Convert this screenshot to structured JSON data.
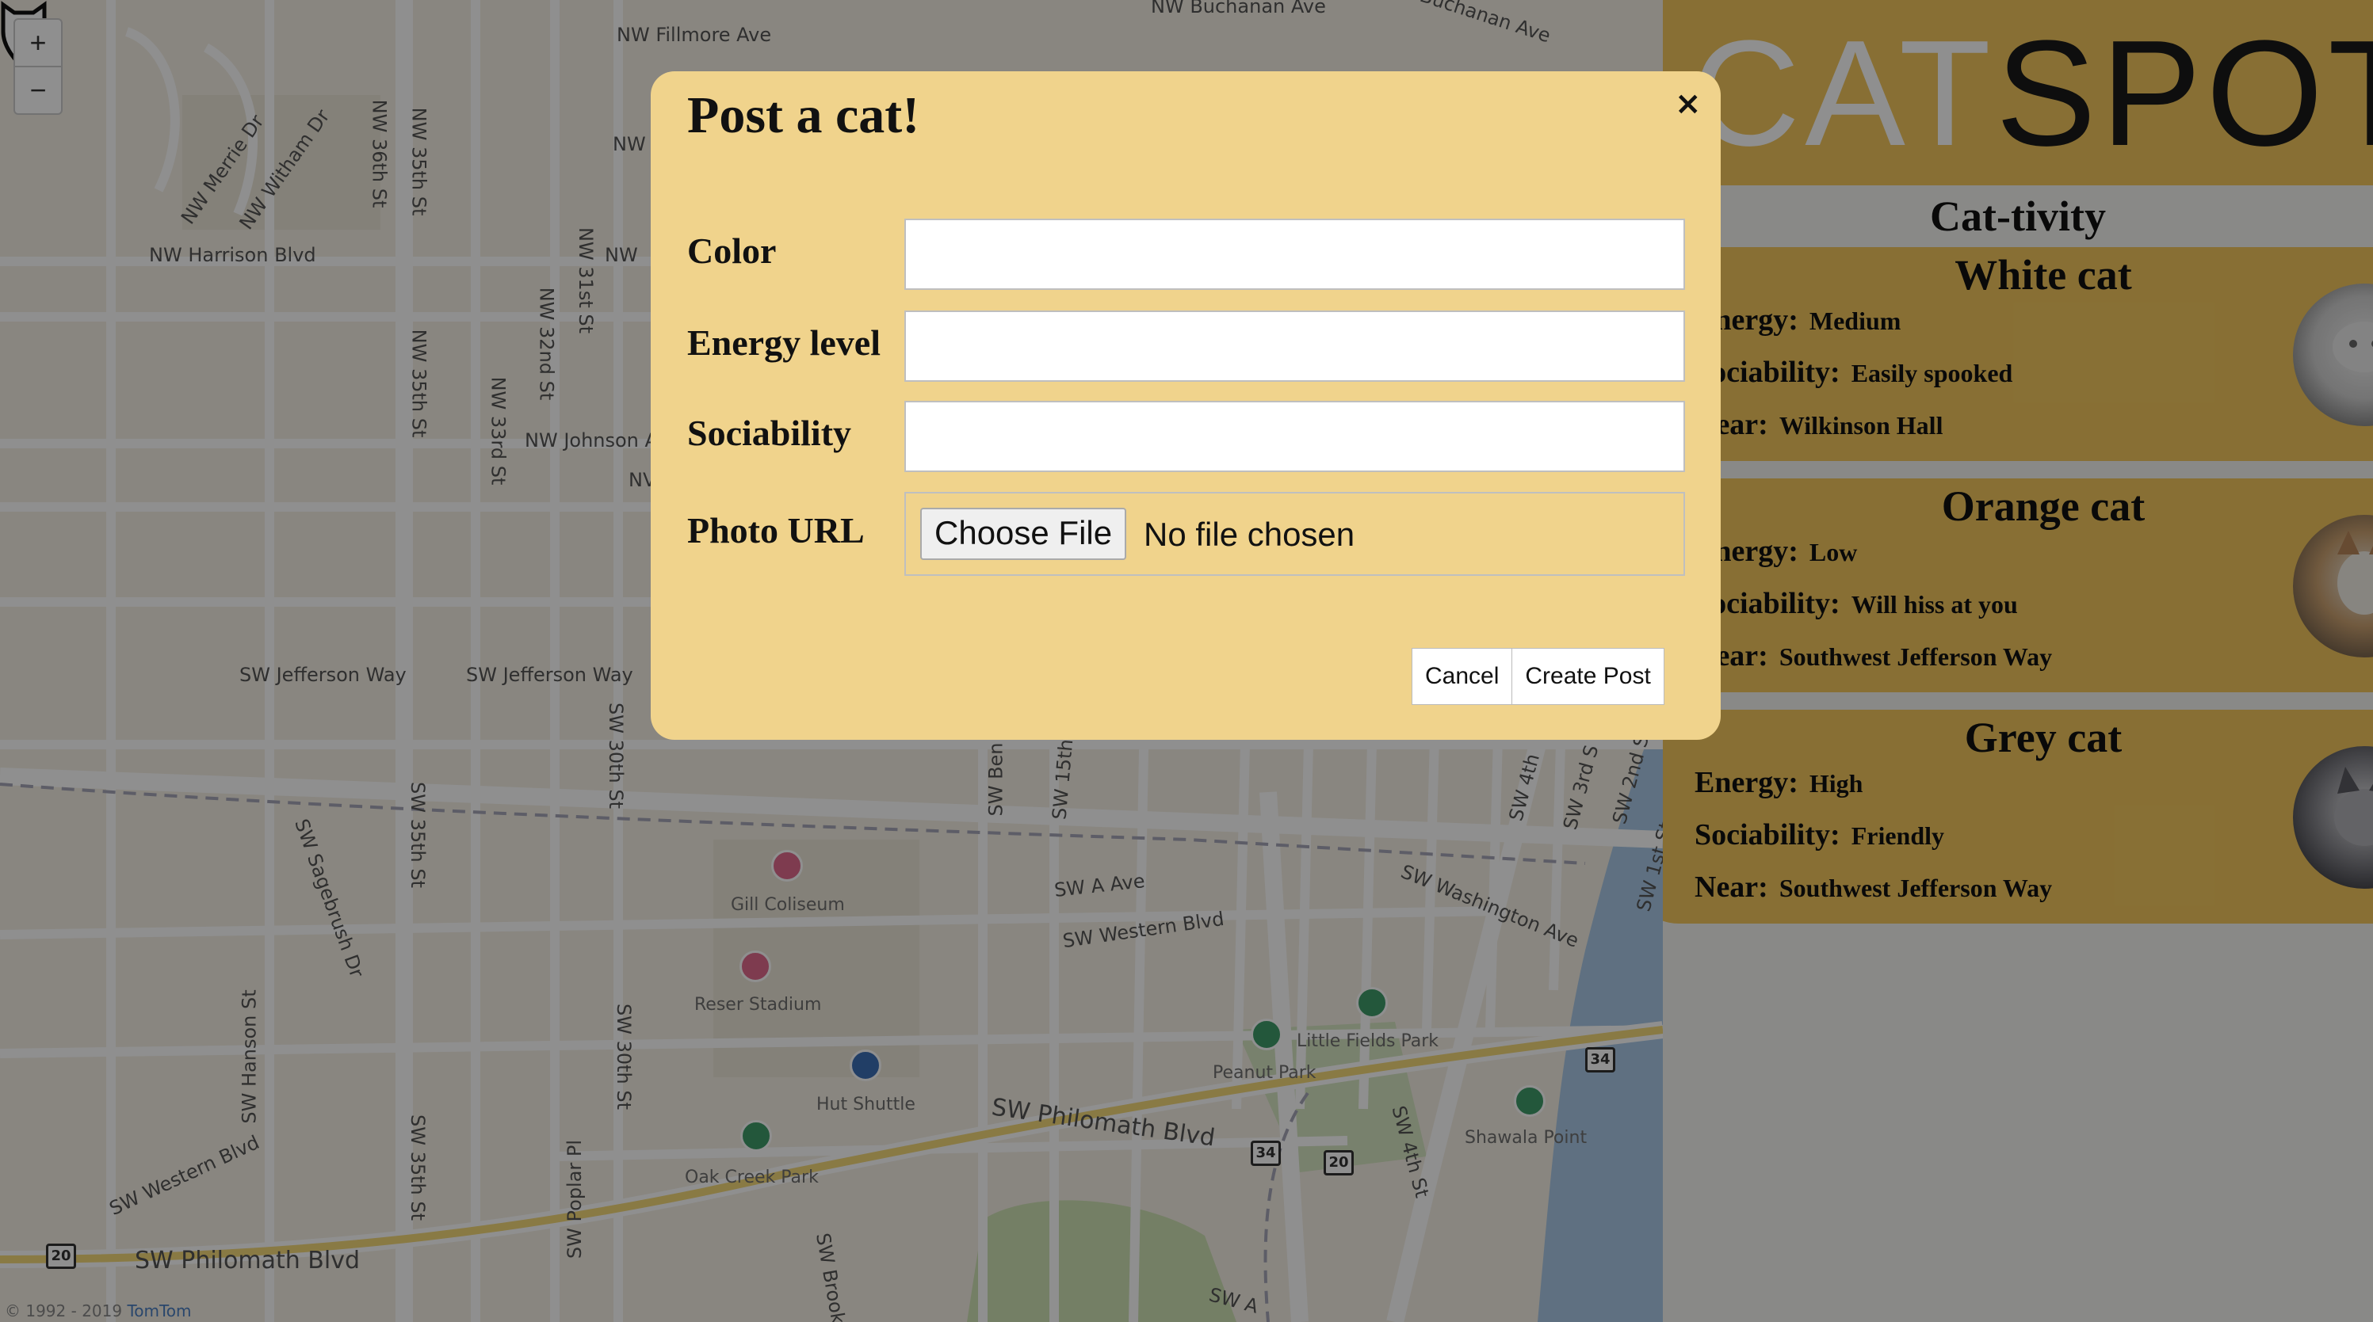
{
  "map": {
    "zoom_in": "+",
    "zoom_out": "−",
    "attribution_prefix": "© 1992 - 2019 ",
    "attribution_link": "TomTom",
    "streets": [
      "NW Fillmore Ave",
      "NW Buchanan Ave",
      "NW Buchanan Ave",
      "NW Harrison Blvd",
      "NW Merrie Dr",
      "NW Witham Dr",
      "NW 36th St",
      "NW 35th St",
      "NW 35th St",
      "NW 33rd St",
      "NW 32nd St",
      "NW 31st St",
      "NW Johnson A",
      "SW Jefferson Way",
      "SW Jefferson Way",
      "SW 30th St",
      "SW Sagebrush Dr",
      "SW 35th St",
      "SW Hanson St",
      "SW 30th St",
      "SW Western Blvd",
      "SW Western Blvd",
      "SW Philomath Blvd",
      "SW Philomath Blvd",
      "SW Poplar Pl",
      "SW 35th St",
      "SW A Ave",
      "SW Washington Ave",
      "SW 4th St",
      "SW 15th",
      "SW Ben",
      "SW 4th",
      "SW 3rd S",
      "SW 2nd S",
      "SW 1st St",
      "NW",
      "NW",
      "NV",
      "SW Brook",
      "SW A"
    ],
    "pois": [
      "Gill Coliseum",
      "Reser Stadium",
      "Hut Shuttle",
      "Oak Creek Park",
      "Little Fields Park",
      "Peanut Park",
      "Shawala Point"
    ],
    "shields": [
      "20",
      "34",
      "20",
      "34",
      "20"
    ],
    "colors": {
      "land": "#f4efe4",
      "road": "#ffffff",
      "river": "#a9c8e6",
      "park": "#cfe3b4"
    }
  },
  "sidebar": {
    "logo_part1": "CAT",
    "logo_part2": "SPOT",
    "activity_title": "Cat-tivity",
    "cats": [
      {
        "name": "White cat",
        "energy_label": "Energy:",
        "energy": "Medium",
        "sociability_label": "Sociability:",
        "sociability": "Easily spooked",
        "near_label": "Near:",
        "near": "Wilkinson Hall",
        "photo": "white-cat-photo"
      },
      {
        "name": "Orange cat",
        "energy_label": "Energy:",
        "energy": "Low",
        "sociability_label": "Sociability:",
        "sociability": "Will hiss at you",
        "near_label": "Near:",
        "near": "Southwest Jefferson Way",
        "photo": "orange-cat-photo"
      },
      {
        "name": "Grey cat",
        "energy_label": "Energy:",
        "energy": "High",
        "sociability_label": "Sociability:",
        "sociability": "Friendly",
        "near_label": "Near:",
        "near": "Southwest Jefferson Way",
        "photo": "grey-cat-photo"
      }
    ],
    "colors": {
      "accent": "#f2c75e",
      "logo_dark": "#1a1a1a"
    }
  },
  "modal": {
    "title": "Post a cat!",
    "close": "×",
    "fields": {
      "color_label": "Color",
      "color_value": "",
      "energy_label": "Energy level",
      "energy_value": "",
      "sociability_label": "Sociability",
      "sociability_value": "",
      "photo_label": "Photo URL",
      "file_button": "Choose File",
      "file_status": "No file chosen"
    },
    "cancel": "Cancel",
    "create": "Create Post",
    "colors": {
      "background": "#f0d38c"
    }
  }
}
